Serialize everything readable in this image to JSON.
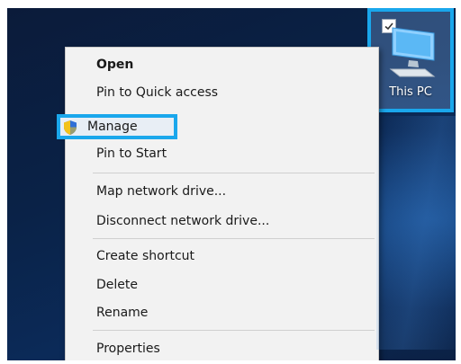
{
  "desktop": {
    "icon_label": "This PC"
  },
  "context_menu": {
    "items": [
      {
        "label": "Open"
      },
      {
        "label": "Pin to Quick access"
      },
      {
        "label": "Manage"
      },
      {
        "label": "Pin to Start"
      },
      {
        "label": "Map network drive..."
      },
      {
        "label": "Disconnect network drive..."
      },
      {
        "label": "Create shortcut"
      },
      {
        "label": "Delete"
      },
      {
        "label": "Rename"
      },
      {
        "label": "Properties"
      }
    ]
  },
  "colors": {
    "highlight_border": "#1aa7ec",
    "menu_background": "#f2f2f2",
    "desktop_background": "#0a2247"
  }
}
